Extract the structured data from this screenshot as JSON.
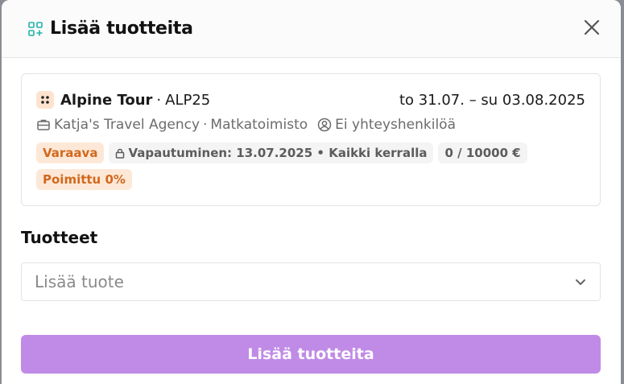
{
  "modal": {
    "title": "Lisää tuotteita",
    "icon": "add-grid-icon",
    "accent_color": "#20b2aa"
  },
  "booking": {
    "tour_name": "Alpine Tour",
    "separator": "·",
    "tour_code": "ALP25",
    "dates": "to 31.07. – su 03.08.2025",
    "agency": "Katja's Travel Agency",
    "agency_type": "Matkatoimisto",
    "contact": "Ei yhteyshenkilöä",
    "status": "Varaava",
    "release": "Vapautuminen: 13.07.2025 • Kaikki kerralla",
    "amount": "0 / 10000 €",
    "picked": "Poimittu 0%",
    "status_color": "#d2691e"
  },
  "products": {
    "label": "Tuotteet",
    "select_placeholder": "Lisää tuote"
  },
  "submit": {
    "label": "Lisää tuotteita",
    "color": "#c08be6"
  }
}
